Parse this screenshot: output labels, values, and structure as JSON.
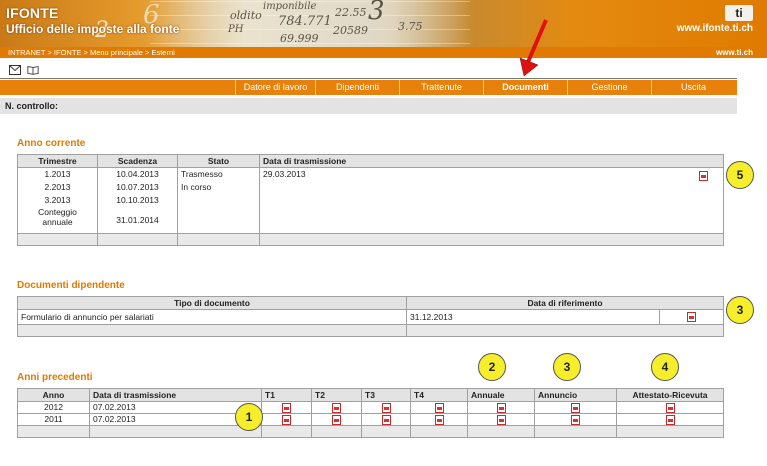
{
  "header": {
    "title": "IFONTE",
    "subtitle": "Ufficio delle imposte alla fonte",
    "site_url": "www.ifonte.ti.ch",
    "site_url_small": "www.ti.ch",
    "logo_text": "ti",
    "breadcrumb": "INTRANET > IFONTE > Menu principale > Esterni",
    "background_text": [
      "784.771",
      "69.999",
      "imponibile",
      "3",
      "6",
      "2",
      "PH",
      "oldito",
      "20589",
      "22.55",
      "3.75"
    ]
  },
  "toolbar": {
    "mail_icon": "envelope-icon",
    "book_icon": "book-icon"
  },
  "nav": {
    "items": [
      "Datore di lavoro",
      "Dipendenti",
      "Trattenute",
      "Documenti",
      "Gestione",
      "Uscita"
    ],
    "active": "Documenti",
    "accent": "#e8810c"
  },
  "control_label": "N. controllo:",
  "anno_corrente": {
    "title": "Anno corrente",
    "headers": [
      "Trimestre",
      "Scadenza",
      "Stato",
      "Data di trasmissione"
    ],
    "trimestri": [
      "1.2013",
      "2.2013",
      "3.2013",
      "Conteggio annuale"
    ],
    "scadenze": [
      "10.04.2013",
      "10.07.2013",
      "10.10.2013",
      "31.01.2014"
    ],
    "stati": [
      "Trasmesso",
      "In corso"
    ],
    "data_trasmissione": "29.03.2013"
  },
  "documenti_dipendente": {
    "title": "Documenti dipendente",
    "headers": [
      "Tipo di documento",
      "Data di riferimento"
    ],
    "row": {
      "tipo": "Formulario di annuncio per salariati",
      "data": "31.12.2013"
    }
  },
  "anni_precedenti": {
    "title": "Anni precedenti",
    "headers": [
      "Anno",
      "Data di trasmissione",
      "T1",
      "T2",
      "T3",
      "T4",
      "Annuale",
      "Annuncio",
      "Attestato-Ricevuta"
    ],
    "rows": [
      {
        "anno": "2012",
        "data": "07.02.2013"
      },
      {
        "anno": "2011",
        "data": "07.02.2013"
      }
    ]
  },
  "callouts": [
    "1",
    "2",
    "3",
    "3",
    "4",
    "5"
  ],
  "colors": {
    "orange": "#e07a00",
    "callout": "#f6ee2a",
    "arrow": "#e01010"
  }
}
